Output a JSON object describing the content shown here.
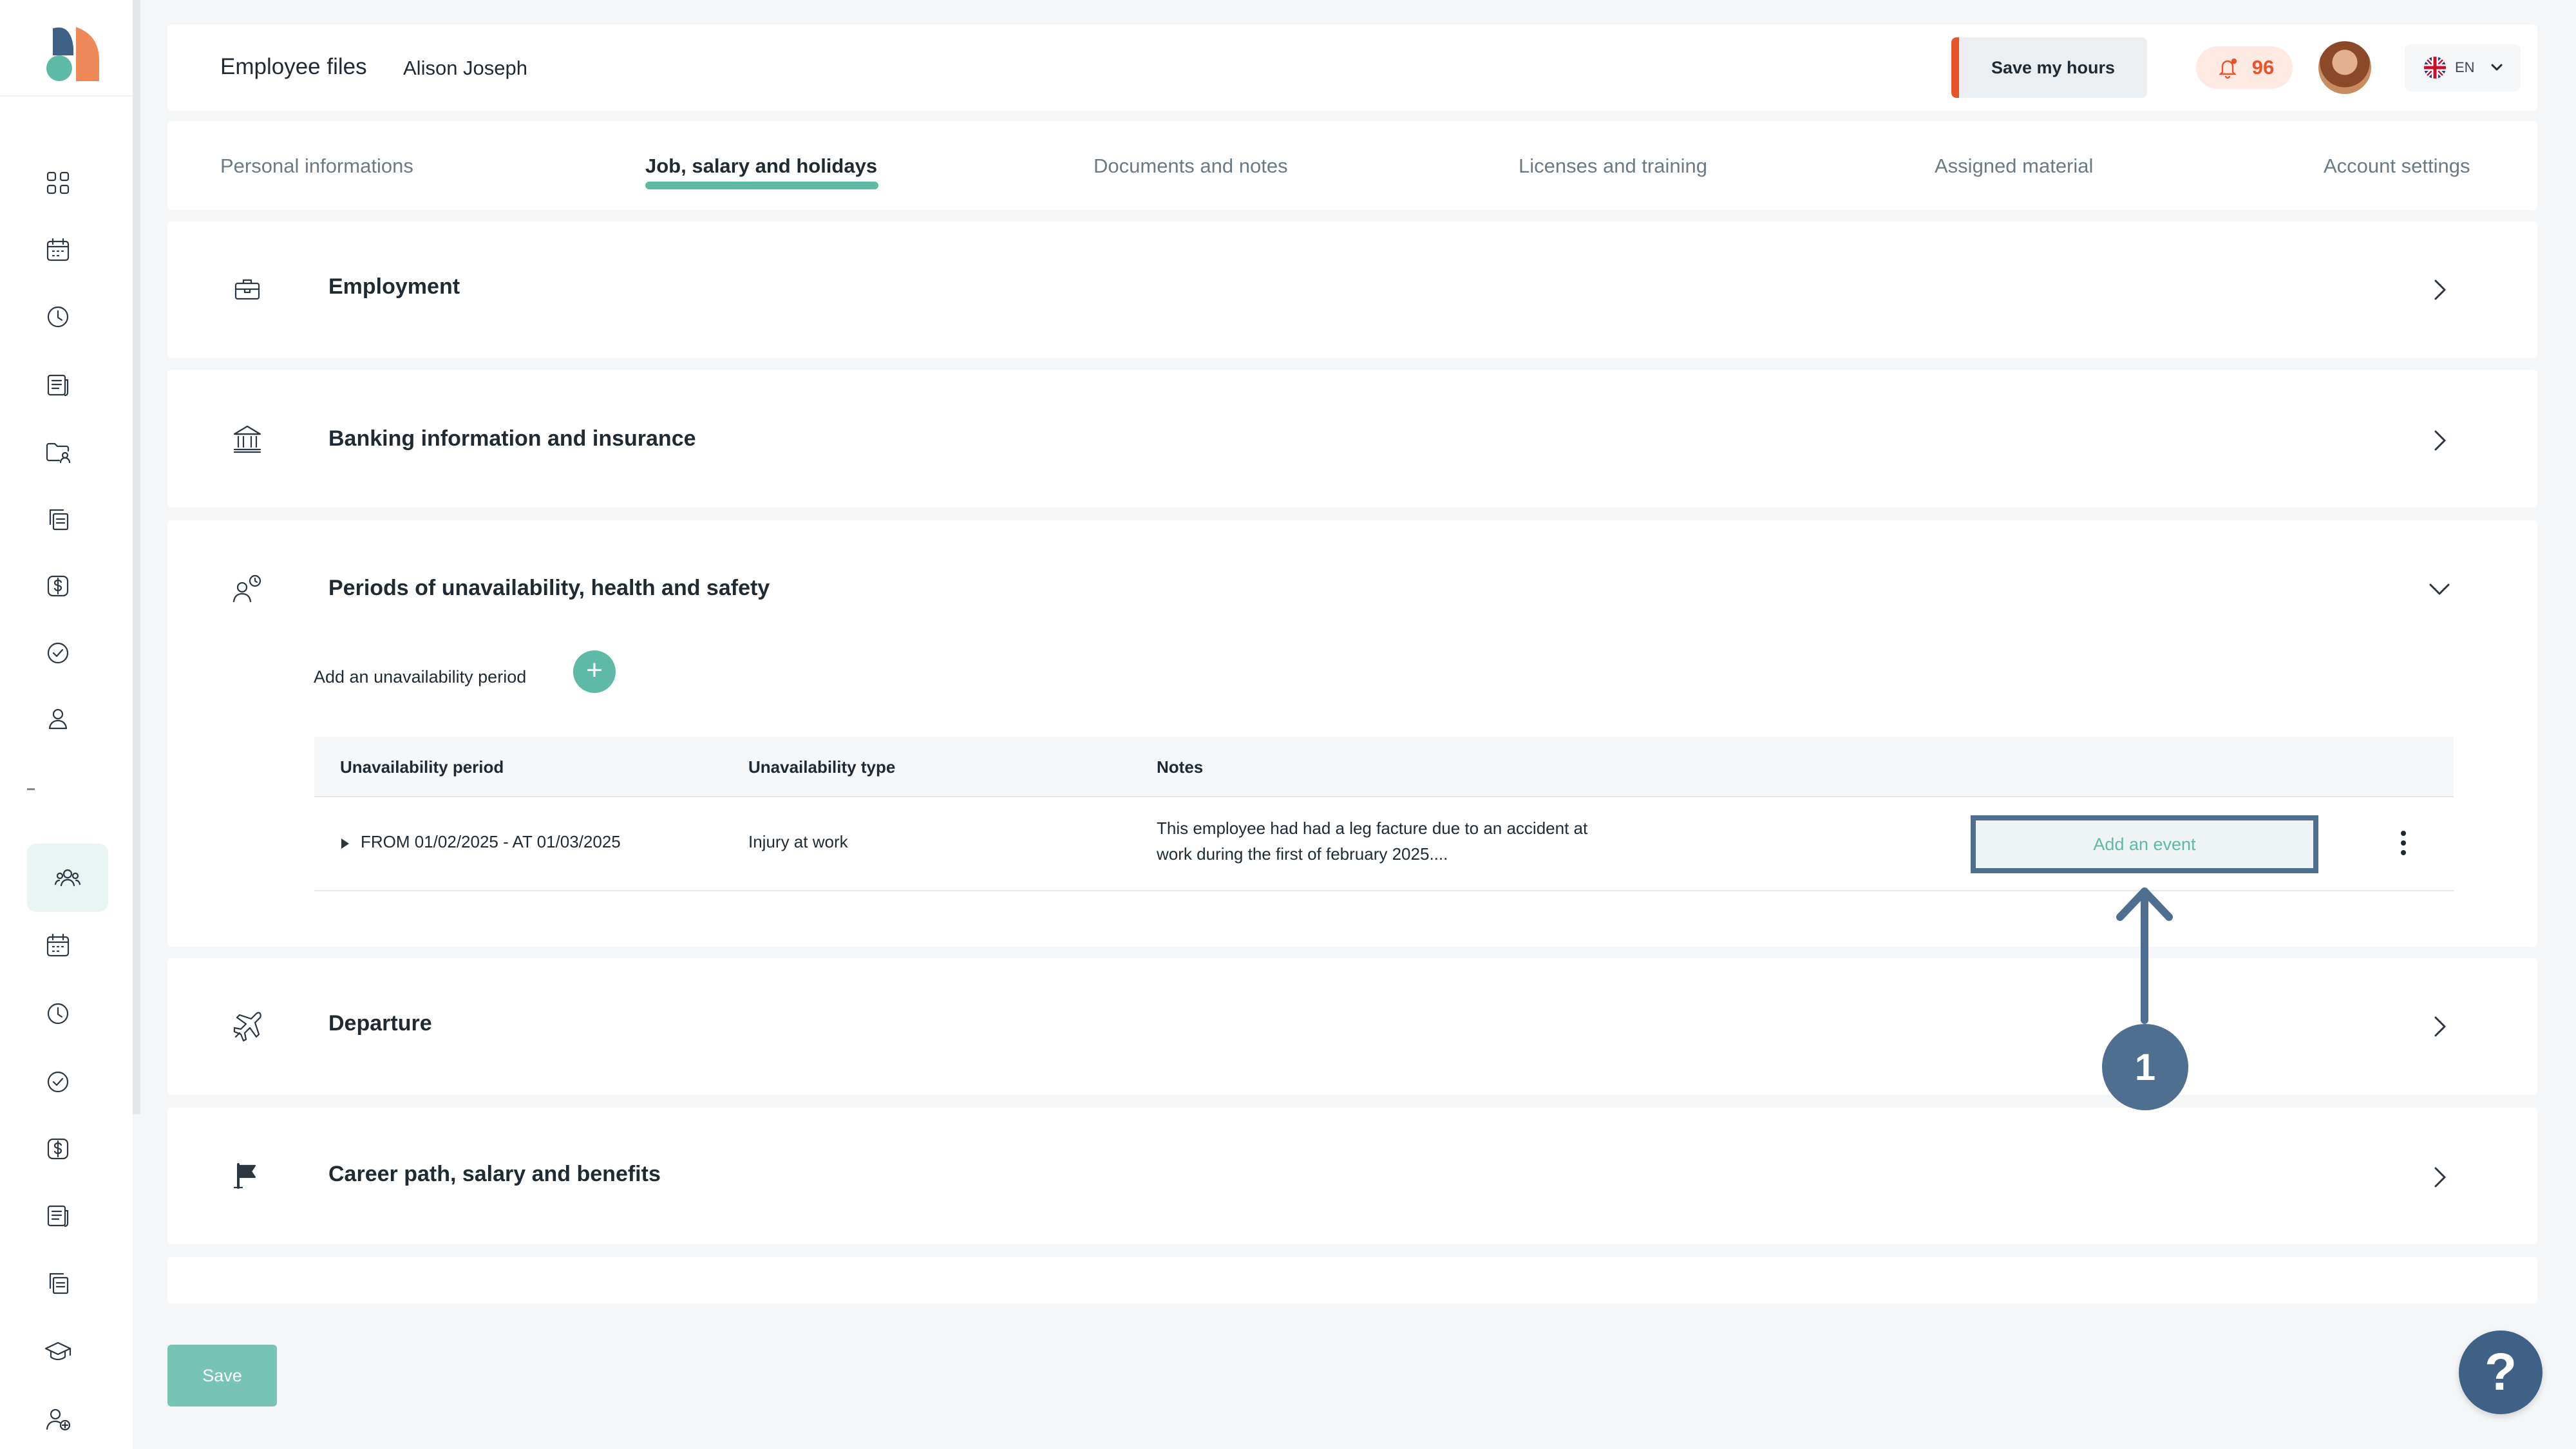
{
  "header": {
    "title": "Employee files",
    "employee_name": "Alison Joseph",
    "save_hours_label": "Save my hours",
    "notification_count": "96",
    "language": "EN"
  },
  "tabs": [
    {
      "label": "Personal informations",
      "active": false
    },
    {
      "label": "Job, salary and holidays",
      "active": true
    },
    {
      "label": "Documents and notes",
      "active": false
    },
    {
      "label": "Licenses and training",
      "active": false
    },
    {
      "label": "Assigned material",
      "active": false
    },
    {
      "label": "Account settings",
      "active": false
    }
  ],
  "sections": {
    "employment": {
      "title": "Employment",
      "icon": "briefcase-icon"
    },
    "banking": {
      "title": "Banking information and insurance",
      "icon": "bank-icon"
    },
    "unavailability": {
      "title": "Periods of unavailability, health and safety",
      "icon": "person-clock-icon",
      "add_label": "Add an unavailability period",
      "add_button": "+",
      "table": {
        "headers": [
          "Unavailability period",
          "Unavailability type",
          "Notes"
        ],
        "rows": [
          {
            "period": "FROM 01/02/2025 - AT 01/03/2025",
            "type": "Injury at work",
            "notes": "This employee had had a leg facture due to an accident at work during the first of february 2025....",
            "action_label": "Add an event"
          }
        ]
      }
    },
    "departure": {
      "title": "Departure",
      "icon": "plane-icon"
    },
    "career": {
      "title": "Career path, salary and benefits",
      "icon": "flag-icon"
    }
  },
  "annotation": {
    "marker": "1"
  },
  "footer": {
    "save_label": "Save",
    "help_label": "?"
  },
  "colors": {
    "accent": "#5fb9a7",
    "alert": "#e8542a",
    "annotation": "#4f6f91",
    "help": "#3f6186"
  }
}
